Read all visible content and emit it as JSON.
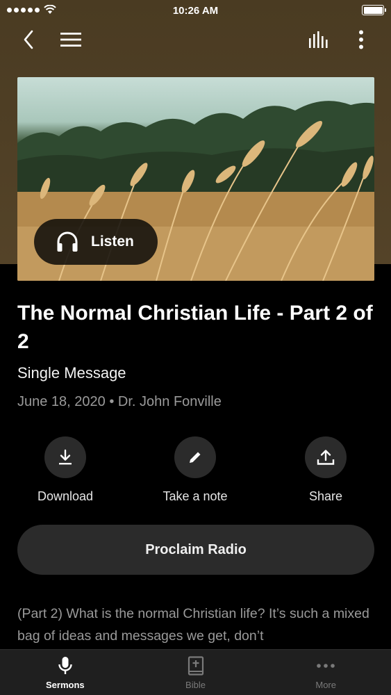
{
  "status_bar": {
    "time": "10:26 AM"
  },
  "sermon": {
    "listen_label": "Listen",
    "title": "The Normal Christian Life - Part 2 of 2",
    "type": "Single Message",
    "date": "June 18, 2020",
    "separator": "•",
    "speaker": "Dr. John Fonville",
    "description": "(Part 2)  What is the normal Christian life?  It’s such a mixed bag of ideas and messages we get, don’t"
  },
  "actions": {
    "download": "Download",
    "note": "Take a note",
    "share": "Share"
  },
  "radio_button": "Proclaim Radio",
  "tabs": [
    {
      "label": "Sermons",
      "icon": "microphone-icon",
      "active": true
    },
    {
      "label": "Bible",
      "icon": "bible-icon",
      "active": false
    },
    {
      "label": "More",
      "icon": "more-icon",
      "active": false
    }
  ],
  "colors": {
    "header_brown": "#4a3b22",
    "background": "#000000",
    "surface": "#2b2b2b",
    "tabbar": "#1f1f1f"
  }
}
